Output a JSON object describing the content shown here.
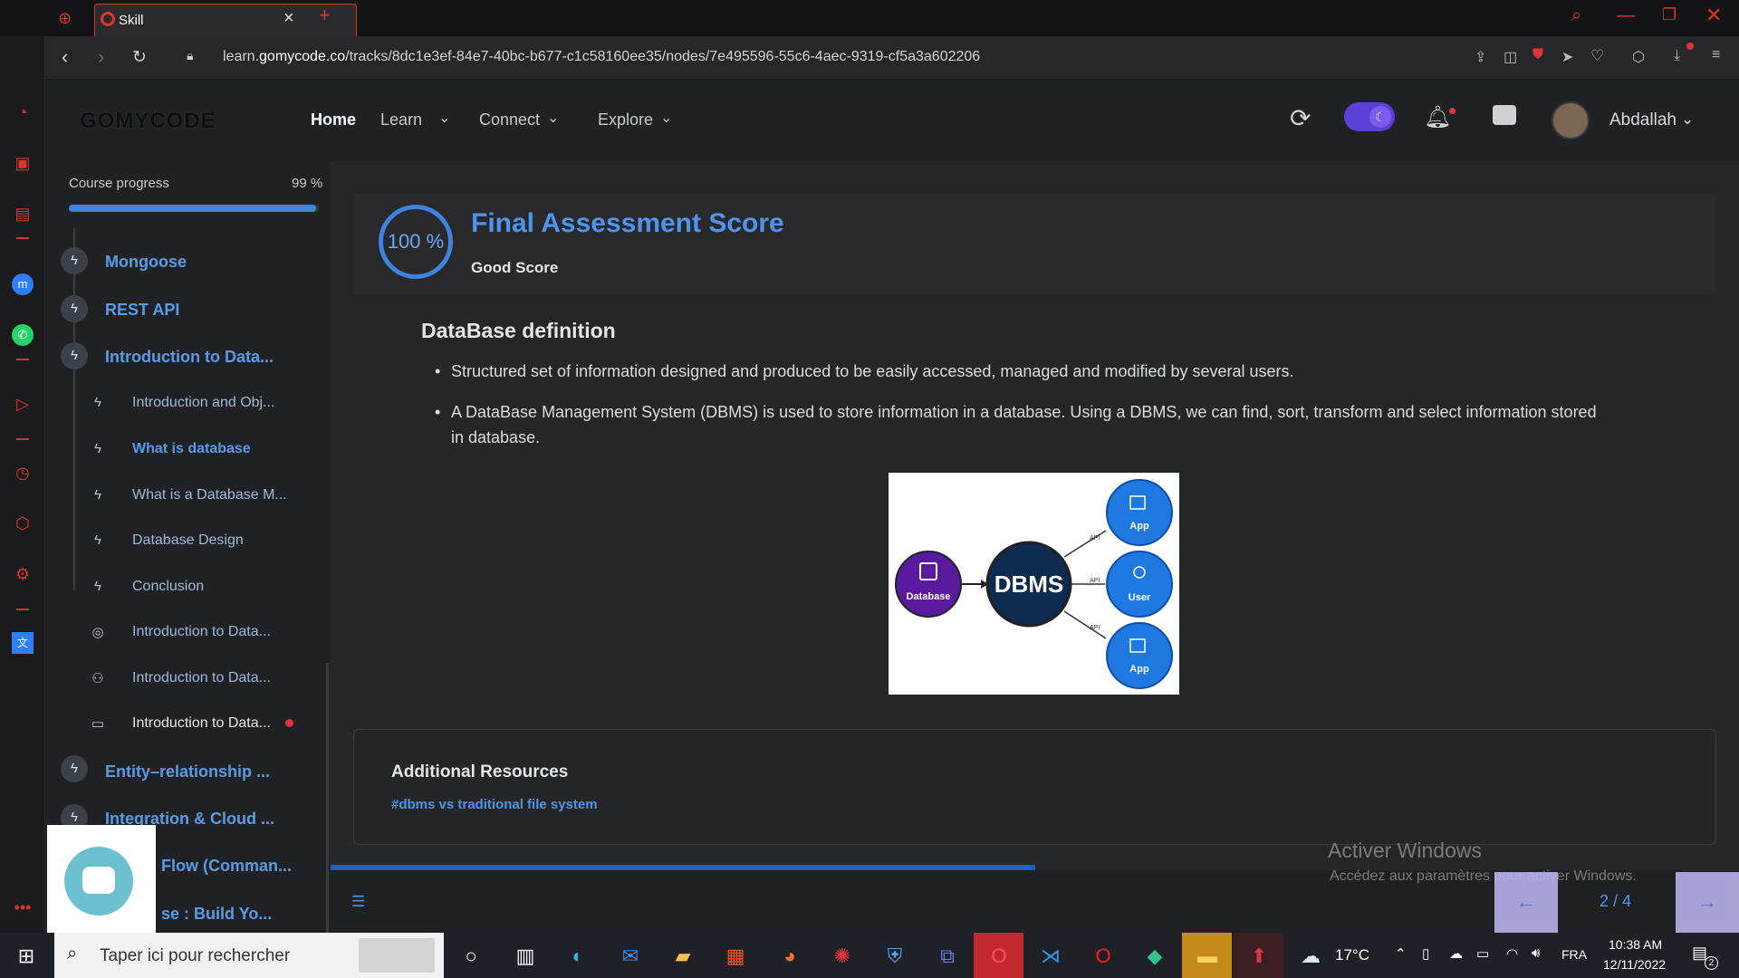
{
  "browser": {
    "tab_title": "Skill",
    "url_prefix": "learn.",
    "url_domain": "gomycode.co",
    "url_path": "/tracks/8dc1e3ef-84e7-40bc-b677-c1c58160ee35/nodes/7e495596-55c6-4aec-9319-cf5a3a602206"
  },
  "header": {
    "logo": "GOMYCODE",
    "nav": [
      "Home",
      "Learn",
      "Connect",
      "Explore"
    ],
    "user_name": "Abdallah"
  },
  "sidebar": {
    "progress_label": "Course progress",
    "progress_value": "99 %",
    "progress_fraction": 0.99,
    "chapters_top": [
      "Mongoose",
      "REST API",
      "Introduction to Data..."
    ],
    "lessons": [
      {
        "label": "Introduction and Obj...",
        "icon": "bolt-icon"
      },
      {
        "label": "What is database",
        "icon": "bolt-icon"
      },
      {
        "label": "What is a Database M...",
        "icon": "bolt-icon"
      },
      {
        "label": "Database Design",
        "icon": "bolt-icon"
      },
      {
        "label": "Conclusion",
        "icon": "bolt-icon"
      },
      {
        "label": "Introduction to Data...",
        "icon": "target-icon"
      },
      {
        "label": "Introduction to Data...",
        "icon": "people-icon"
      },
      {
        "label": "Introduction to Data...",
        "icon": "presentation-icon"
      }
    ],
    "chapters_bottom": [
      "Entity–relationship ...",
      "Integration & Cloud ...",
      "Flow (Comman...",
      "se : Build Yo..."
    ]
  },
  "score": {
    "percent": "100 %",
    "title": "Final Assessment Score",
    "subtitle": "Good Score"
  },
  "content": {
    "heading": "DataBase definition",
    "bullets": [
      "Structured set of information designed and produced to be easily accessed, managed and modified by several users.",
      "A DataBase Management System (DBMS) is used to store information in a database. Using a DBMS, we can find, sort, transform and select information stored in database."
    ],
    "diagram": {
      "center": "DBMS",
      "left": "Database",
      "right": [
        "App",
        "User",
        "App"
      ],
      "edge_label": "API"
    }
  },
  "resources": {
    "title": "Additional Resources",
    "link": "#dbms vs traditional file system"
  },
  "pager": {
    "page": "2 / 4",
    "progress_fraction": 0.5
  },
  "watermark": {
    "line1": "Activer Windows",
    "line2": "Accédez aux paramètres pour activer Windows."
  },
  "taskbar": {
    "search_placeholder": "Taper ici pour rechercher",
    "weather": "17°C",
    "lang": "FRA",
    "time": "10:38 AM",
    "date": "12/11/2022",
    "notif_count": "2"
  },
  "colors": {
    "accent": "#3d84e0",
    "brand_red": "#d9362c",
    "toggle": "#5b3fd6"
  }
}
